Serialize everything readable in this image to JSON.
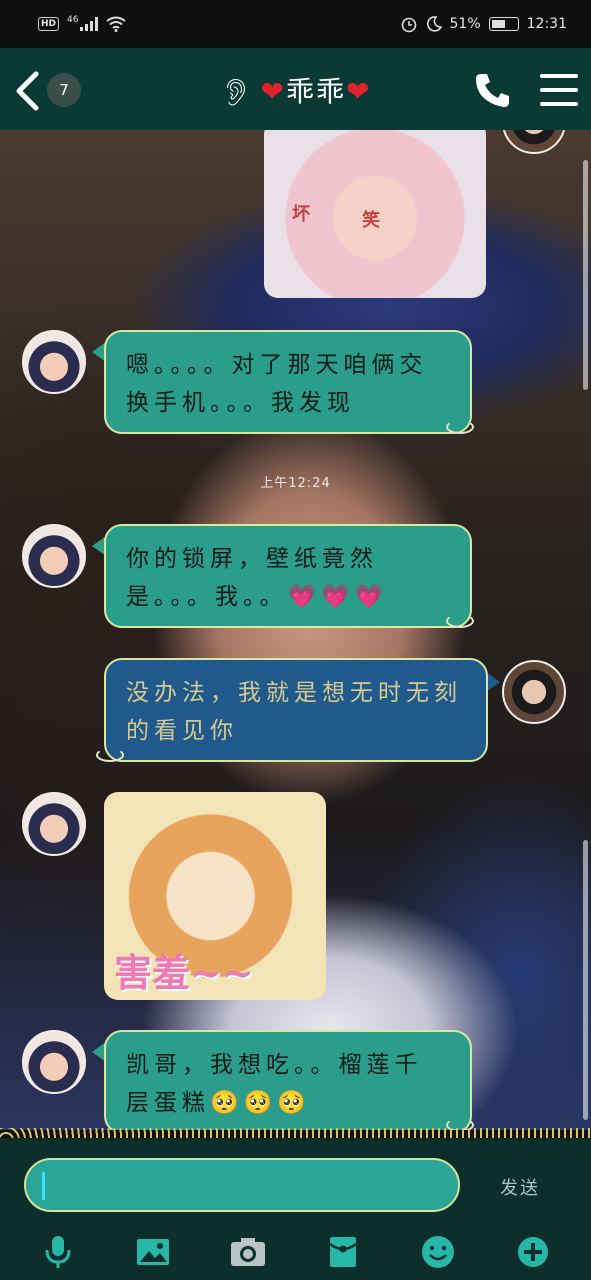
{
  "status_bar": {
    "hd": "HD",
    "network": "46",
    "battery": "51%",
    "time": "12:31"
  },
  "header": {
    "unread_count": "7",
    "title": "乖乖",
    "heart_left": "❤",
    "heart_right": "❤"
  },
  "messages": {
    "img1_caption_left": "坏",
    "img1_caption_right": "笑",
    "msg1": "嗯。。。。对了那天咱俩交换手机。。。我发现",
    "timestamp": "上午12:24",
    "msg2_text": "你的锁屏，壁纸竟然是。。。我。。",
    "msg2_emoji": "💗💗💗",
    "msg3": "没办法，我就是想无时无刻的看见你",
    "img2_caption": "害羞~~",
    "msg4_text": "凯哥，我想吃。。榴莲千层蛋糕",
    "msg4_emoji": "🥺🥺🥺"
  },
  "input": {
    "value": "",
    "send_label": "发送"
  },
  "toolbar": [
    "mic-icon",
    "image-icon",
    "camera-icon",
    "red-envelope-icon",
    "emoji-icon",
    "plus-icon"
  ],
  "colors": {
    "header": "#0b3a34",
    "bubble_in": "#2a9e8b",
    "bubble_out": "#205a8c",
    "input": "#2aa598"
  }
}
